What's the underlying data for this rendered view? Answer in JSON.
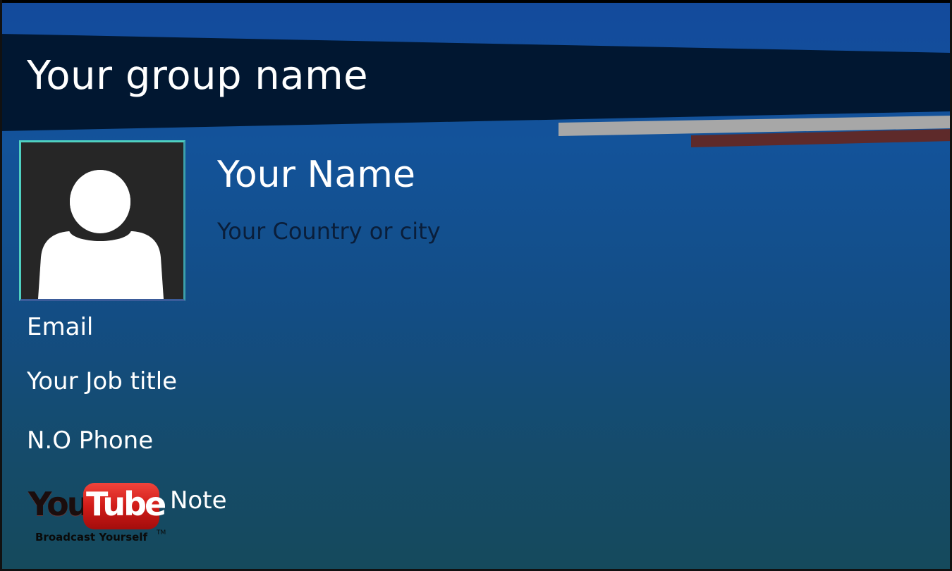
{
  "header": {
    "group_name": "Your group name"
  },
  "profile": {
    "name": "Your Name",
    "location": "Your Country or city",
    "avatar_icon": "user-silhouette-icon"
  },
  "fields": {
    "email": "Email",
    "job_title": "Your Job title",
    "phone": "N.O Phone",
    "note": "Note"
  },
  "youtube": {
    "you": "You",
    "tube": "Tube",
    "tagline": "Broadcast Yourself",
    "tm": "TM",
    "icon": "youtube-logo-icon"
  },
  "colors": {
    "background_top": "#134a9c",
    "background_bottom": "#154a5c",
    "header_band": "#011731",
    "accent_gray": "#a7a7a7",
    "accent_red": "#5e2a2a",
    "avatar_border": "#4fd0c0",
    "youtube_red": "#d11c18"
  }
}
